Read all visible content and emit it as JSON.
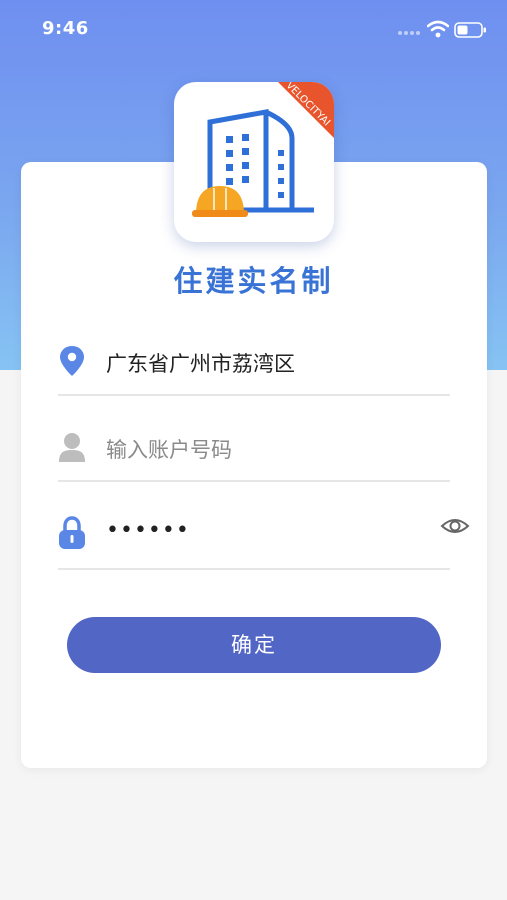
{
  "status_bar": {
    "time": "9:46"
  },
  "logo": {
    "badge_text": "VELOCITYAI"
  },
  "app": {
    "title": "住建实名制"
  },
  "form": {
    "location": {
      "value": "广东省广州市荔湾区"
    },
    "account": {
      "placeholder": "输入账户号码",
      "value": ""
    },
    "password": {
      "masked": "••••••"
    }
  },
  "submit": {
    "label": "确定"
  },
  "colors": {
    "accent": "#3a73d6",
    "button": "#5266c6",
    "hero": "#6f8ff0"
  }
}
